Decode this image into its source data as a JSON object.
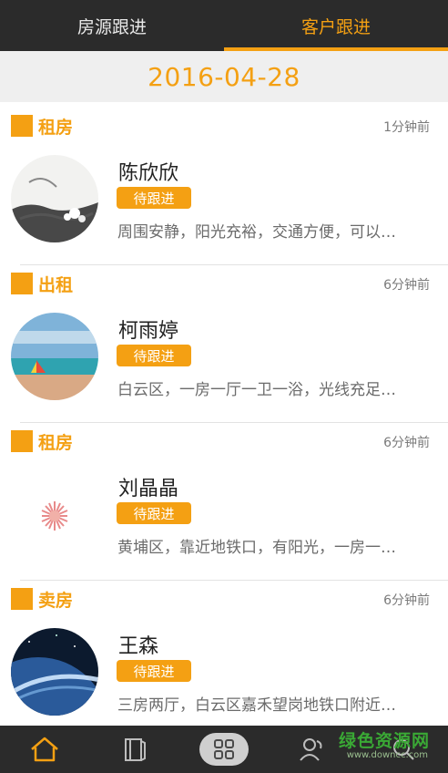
{
  "tabs": [
    {
      "label": "房源跟进",
      "active": false
    },
    {
      "label": "客户跟进",
      "active": true
    }
  ],
  "date": "2016-04-28",
  "colors": {
    "accent": "#f4a013",
    "dark": "#2b2b2b"
  },
  "items": [
    {
      "type": "租房",
      "time": "1分钟前",
      "name": "陈欣欣",
      "status": "待跟进",
      "desc": "周围安静，阳光充裕，交通方便，可以…",
      "avatar": "ink-painting-avatar"
    },
    {
      "type": "出租",
      "time": "6分钟前",
      "name": "柯雨婷",
      "status": "待跟进",
      "desc": "白云区，一房一厅一卫一浴，光线充足…",
      "avatar": "beach-avatar"
    },
    {
      "type": "租房",
      "time": "6分钟前",
      "name": "刘晶晶",
      "status": "待跟进",
      "desc": "黄埔区，靠近地铁口，有阳光，一房一…",
      "avatar": "flower-avatar"
    },
    {
      "type": "卖房",
      "time": "6分钟前",
      "name": "王森",
      "status": "待跟进",
      "desc": "三房两厅，白云区嘉禾望岗地铁口附近…",
      "avatar": "planet-avatar"
    }
  ],
  "bottom_nav": [
    {
      "icon": "home-icon",
      "active": true
    },
    {
      "icon": "book-icon",
      "active": false
    },
    {
      "icon": "grid-icon",
      "active": false
    },
    {
      "icon": "contacts-icon",
      "active": false
    },
    {
      "icon": "search-icon",
      "active": false
    }
  ],
  "watermark": {
    "main": "绿色资源网",
    "sub": "www.downcc.com"
  }
}
